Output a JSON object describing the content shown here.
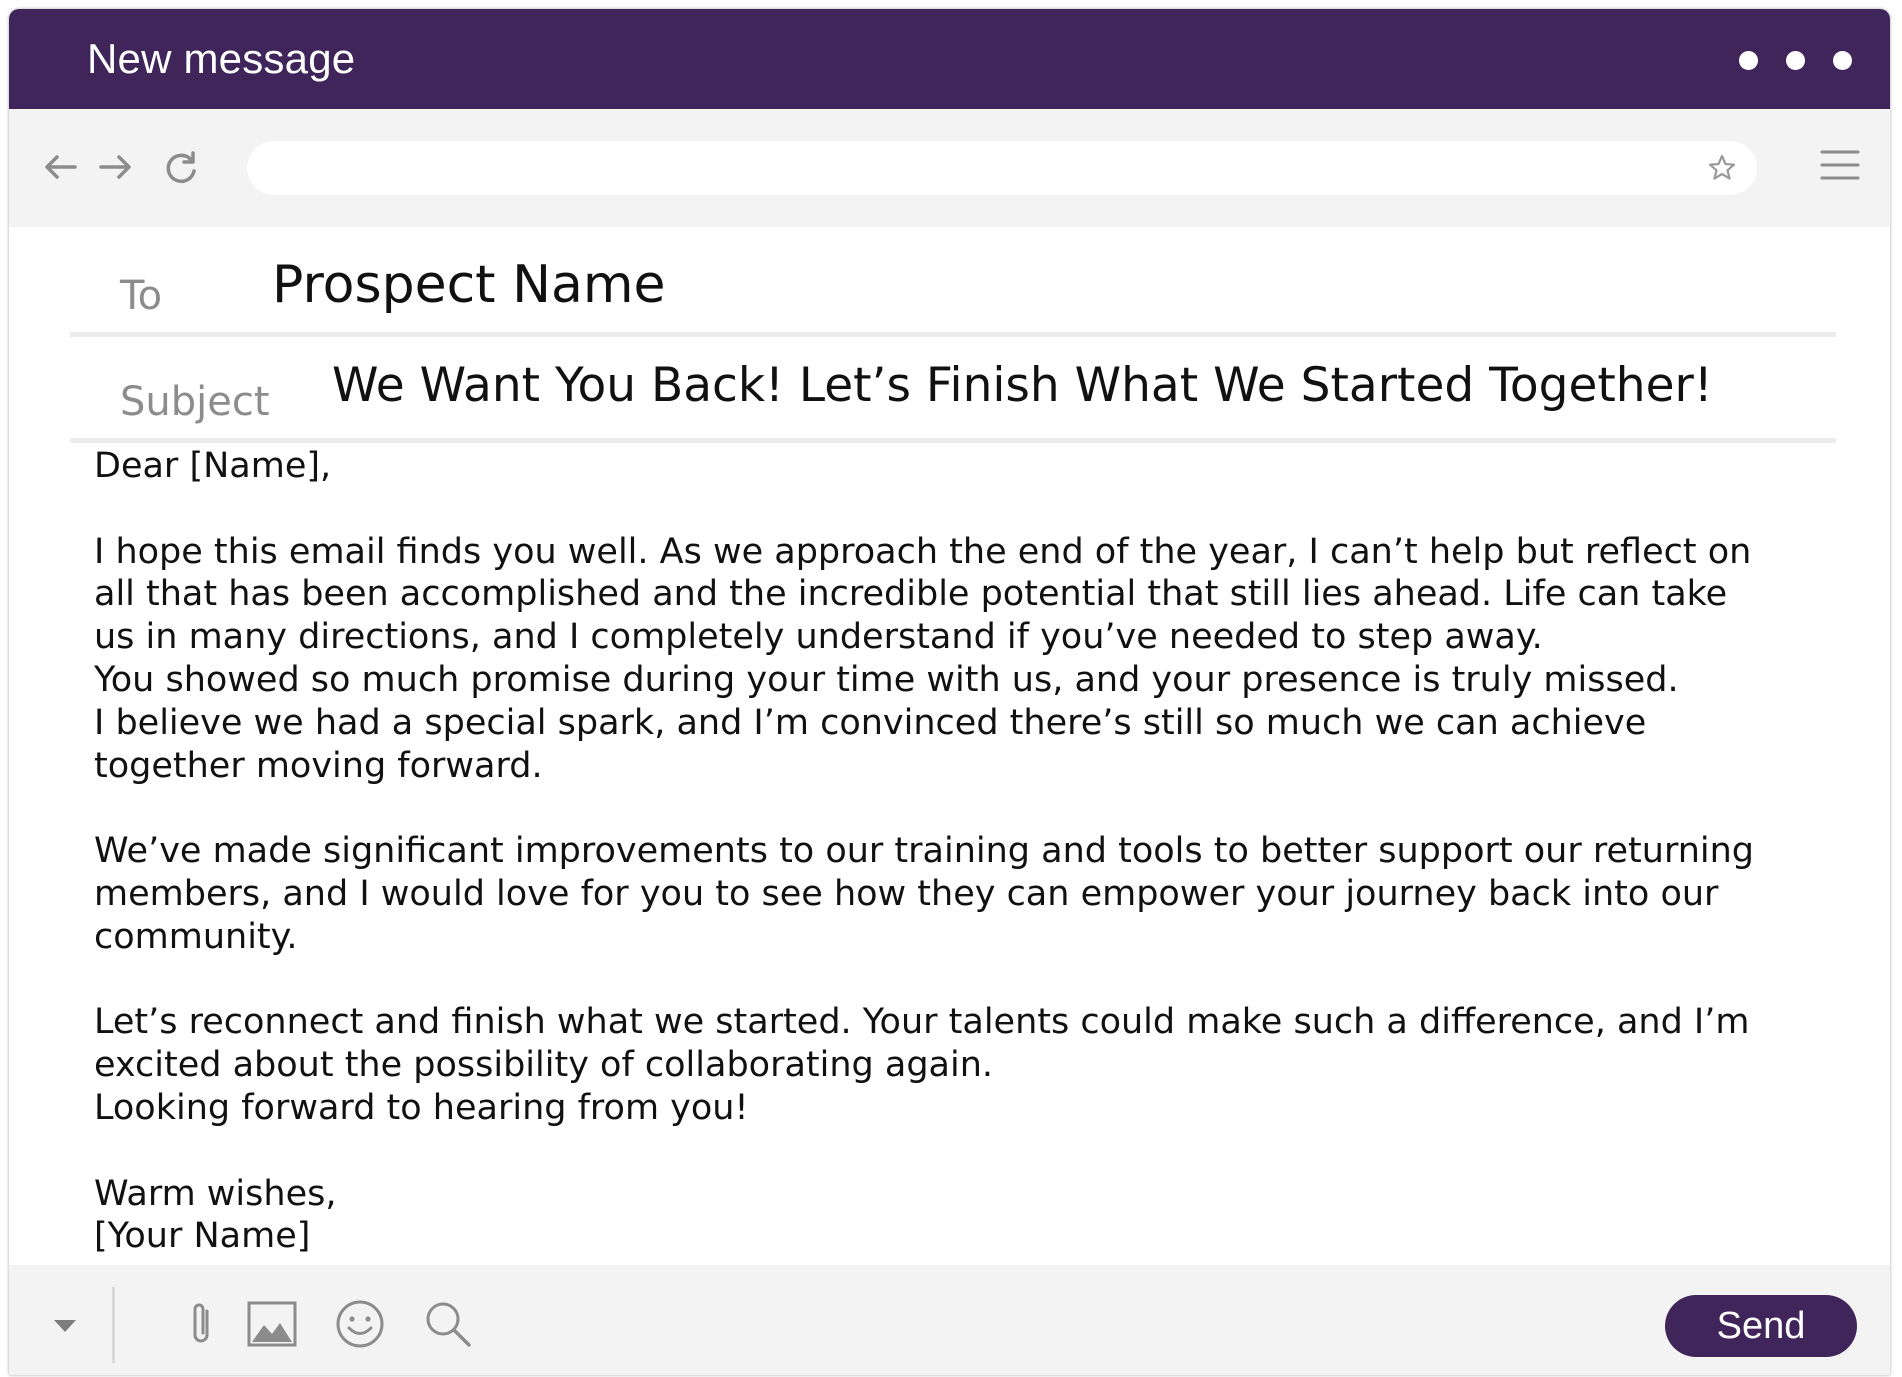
{
  "window": {
    "title": "New message"
  },
  "colors": {
    "brand": "#40255a",
    "chrome": "#f3f3f3",
    "icon": "#8c8c8c",
    "text": "#111111"
  },
  "toolbar": {
    "icons": [
      "back-arrow-icon",
      "forward-arrow-icon",
      "reload-icon",
      "star-icon",
      "hamburger-menu-icon"
    ],
    "url_value": ""
  },
  "compose": {
    "to_label": "To",
    "to_value": "Prospect Name",
    "subject_label": "Subject",
    "subject_value": "We Want You Back! Let’s Finish What We Started Together!"
  },
  "body": {
    "greeting": "Dear [Name],",
    "lines": [
      "I hope this email finds you well. As we approach the end of the year, I can’t help but reflect on",
      "all that has been accomplished and the incredible potential that still lies ahead. Life can take",
      "us in many directions, and I completely understand if you’ve needed to step away.",
      "You showed so much promise during your time with us, and your presence is truly missed.",
      "I believe we had a special spark, and I’m convinced there’s still so much we can achieve",
      "together moving forward.",
      "We’ve made significant improvements to our training and tools to better support our returning",
      "members, and I would love for you to see how they can empower your journey back into our",
      "community.",
      "Let’s reconnect and finish what we started. Your talents could make such a difference, and I’m",
      "excited about the possibility of collaborating again.",
      "Looking forward to hearing from you!",
      "Warm wishes,",
      "[Your Name]"
    ]
  },
  "footer": {
    "icons": [
      "chevron-down-icon",
      "paperclip-icon",
      "image-icon",
      "emoji-icon",
      "search-icon"
    ],
    "send_label": "Send"
  }
}
